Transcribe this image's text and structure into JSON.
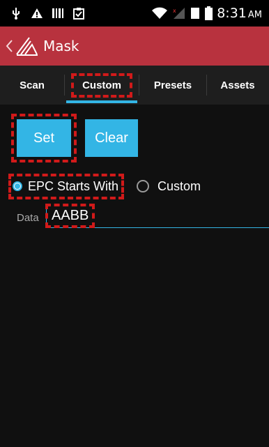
{
  "status_bar": {
    "time": "8:31",
    "ampm": "AM",
    "icons": [
      "usb-icon",
      "warning-icon",
      "barcode-icon",
      "clipboard-icon",
      "wifi-icon",
      "signal-icon",
      "sim-icon",
      "battery-icon"
    ]
  },
  "action_bar": {
    "title": "Mask"
  },
  "tabs": [
    {
      "label": "Scan"
    },
    {
      "label": "Custom"
    },
    {
      "label": "Presets"
    },
    {
      "label": "Assets"
    }
  ],
  "buttons": {
    "set_label": "Set",
    "clear_label": "Clear"
  },
  "radio": {
    "option1": "EPC Starts With",
    "option2": "Custom"
  },
  "data_field": {
    "label": "Data",
    "value": "AABB"
  },
  "colors": {
    "accent": "#33b5e5",
    "action_bar": "#b8323e",
    "highlight": "#d11a1a"
  }
}
